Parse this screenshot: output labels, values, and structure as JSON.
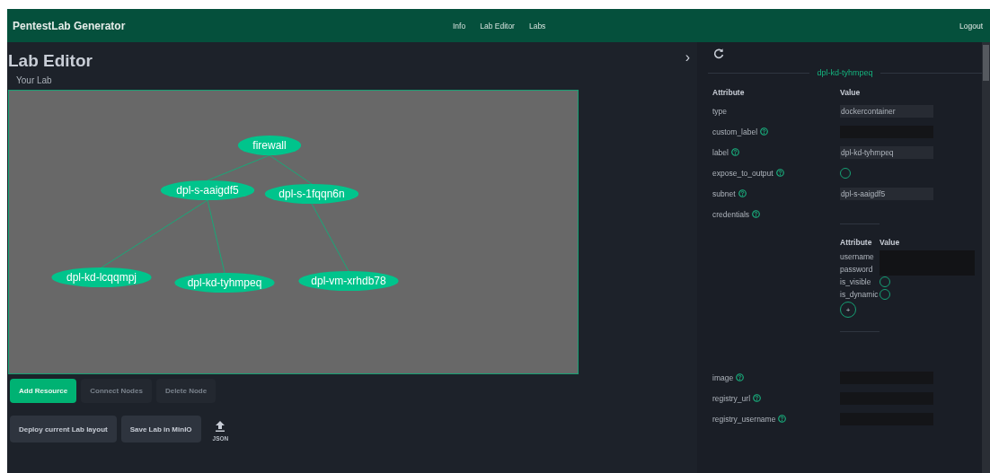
{
  "app": {
    "title": "PentestLab Generator",
    "nav": [
      {
        "label": "Info"
      },
      {
        "label": "Lab Editor"
      },
      {
        "label": "Labs"
      }
    ],
    "logout": "Logout"
  },
  "editor": {
    "title": "Lab Editor",
    "subtitle": "Your Lab",
    "collapse": "›",
    "graph": {
      "label": "firewall",
      "children": [
        {
          "label": "dpl-s-aaigdf5",
          "children": [
            {
              "label": "dpl-kd-lcqqmpj"
            },
            {
              "label": "dpl-kd-tyhmpeq"
            }
          ]
        },
        {
          "label": "dpl-s-1fqqn6n",
          "children": [
            {
              "label": "dpl-vm-xrhdb78"
            }
          ]
        }
      ]
    },
    "actions": [
      {
        "label": "Add Resource",
        "disabled": false
      },
      {
        "label": "Connect Nodes",
        "disabled": true
      },
      {
        "label": "Delete Node",
        "disabled": true
      }
    ],
    "deploy": "Deploy current Lab layout",
    "save": "Save Lab in MinIO",
    "upload": "JSON"
  },
  "panel": {
    "node_title": "dpl-kd-tyhmpeq",
    "header": [
      "Attribute",
      "Value"
    ],
    "rows": [
      {
        "name": "type",
        "kind": "text",
        "value": "dockercontainer",
        "help": false
      },
      {
        "name": "custom_label",
        "kind": "text",
        "help": true
      },
      {
        "name": "label",
        "kind": "text",
        "value": "dpl-kd-tyhmpeq",
        "help": true
      },
      {
        "name": "expose_to_output",
        "kind": "checkbox",
        "checked": false,
        "help": true
      },
      {
        "name": "subnet",
        "kind": "text",
        "value": "dpl-s-aaigdf5",
        "help": true
      },
      {
        "name": "credentials",
        "kind": "credentials",
        "help": true,
        "header": [
          "Attribute",
          "Value"
        ],
        "add": "+",
        "fields": [
          {
            "name": "username",
            "kind": "text"
          },
          {
            "name": "password",
            "kind": "text"
          },
          {
            "name": "is_visible",
            "kind": "checkbox",
            "checked": false
          },
          {
            "name": "is_dynamic",
            "kind": "checkbox",
            "checked": false
          }
        ]
      },
      {
        "name": "image",
        "kind": "text",
        "help": true
      },
      {
        "name": "registry_url",
        "kind": "text",
        "help": true
      },
      {
        "name": "registry_username",
        "kind": "text",
        "help": true
      }
    ]
  }
}
